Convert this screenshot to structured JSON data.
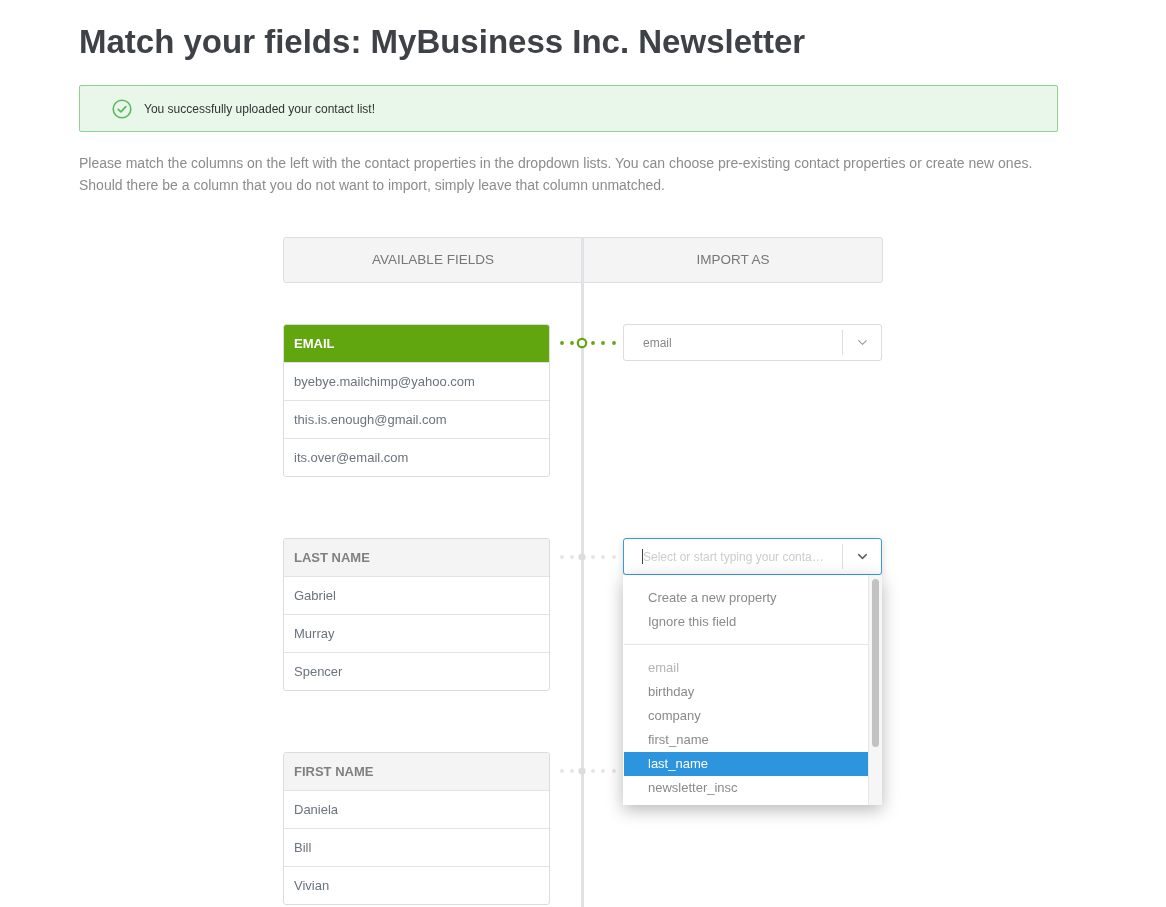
{
  "page": {
    "title": "Match your fields: MyBusiness Inc. Newsletter"
  },
  "alert": {
    "kind": "success",
    "message": "You successfully uploaded your contact list!"
  },
  "instructions": "Please match the columns on the left with the contact properties in the dropdown lists. You can choose pre-existing contact properties or create new ones. Should there be a column that you do not want to import, simply leave that column unmatched.",
  "mapping": {
    "columns": [
      "AVAILABLE FIELDS",
      "IMPORT AS"
    ],
    "fields": [
      {
        "name": "EMAIL",
        "matched": true,
        "values": [
          "byebye.mailchimp@yahoo.com",
          "this.is.enough@gmail.com",
          "its.over@email.com"
        ],
        "select": {
          "value": "email",
          "focused": false,
          "expanded": false
        }
      },
      {
        "name": "LAST NAME",
        "matched": false,
        "values": [
          "Gabriel",
          "Murray",
          "Spencer"
        ],
        "select": {
          "placeholder": "Select or start typing your conta…",
          "focused": true,
          "expanded": true,
          "dropdown": {
            "actions": [
              {
                "label": "Create a new property"
              },
              {
                "label": "Ignore this field"
              }
            ],
            "options": [
              {
                "label": "email",
                "disabled": true,
                "selected": false
              },
              {
                "label": "birthday",
                "disabled": false,
                "selected": false
              },
              {
                "label": "company",
                "disabled": false,
                "selected": false
              },
              {
                "label": "first_name",
                "disabled": false,
                "selected": false
              },
              {
                "label": "last_name",
                "disabled": false,
                "selected": true
              },
              {
                "label": "newsletter_insc",
                "disabled": false,
                "selected": false
              }
            ]
          }
        }
      },
      {
        "name": "FIRST NAME",
        "matched": false,
        "values": [
          "Daniela",
          "Bill",
          "Vivian"
        ]
      }
    ]
  }
}
